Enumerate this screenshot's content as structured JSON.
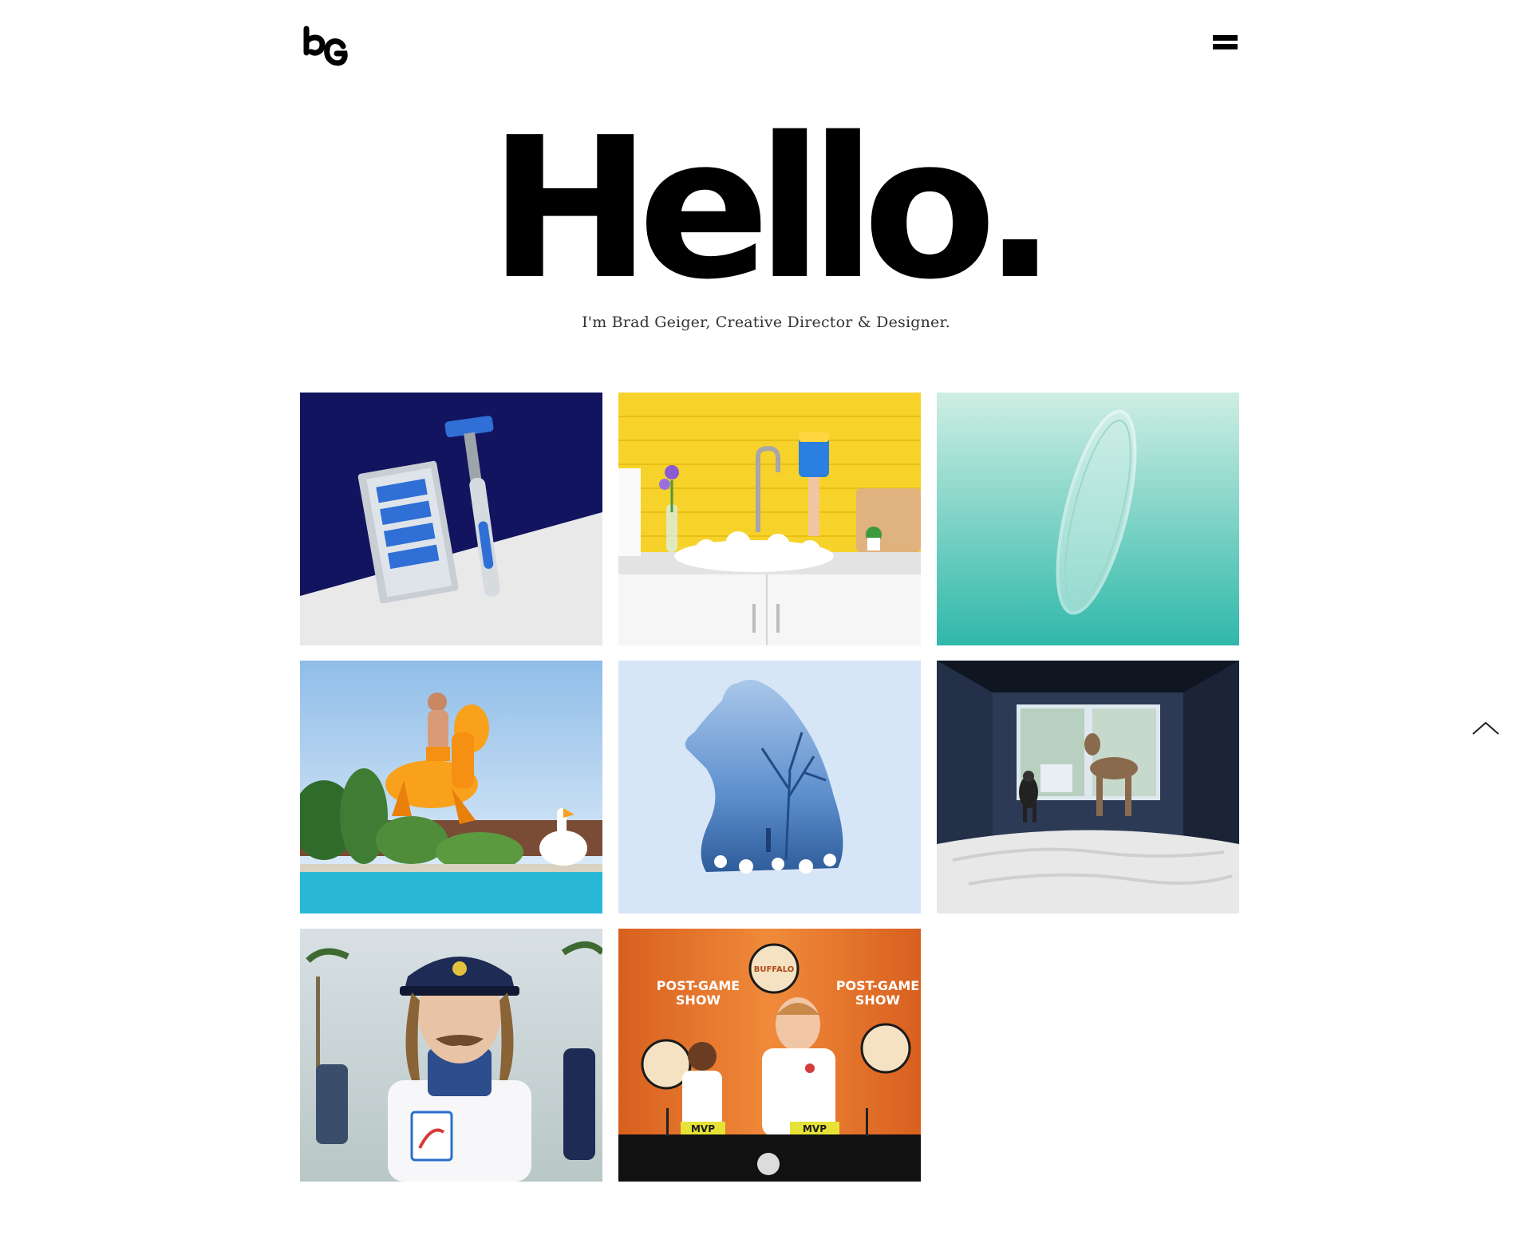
{
  "header": {
    "logo": "bG",
    "logo_icon": "bg-monogram-logo",
    "menu_icon": "hamburger-menu-icon"
  },
  "hero": {
    "headline": "Hello.",
    "subtitle": "I'm Brad Geiger, Creative Director & Designer."
  },
  "portfolio": {
    "items": [
      {
        "icon": "razor-product-image",
        "accent": "#13145f"
      },
      {
        "icon": "kitchen-sink-image",
        "accent": "#f7d22a"
      },
      {
        "icon": "glass-lens-image",
        "accent": "#3cbfae"
      },
      {
        "icon": "pool-inflatable-image",
        "accent": "#f9a11b"
      },
      {
        "icon": "bear-silhouette-image",
        "accent": "#5d8fcd"
      },
      {
        "icon": "dogs-on-bed-image",
        "accent": "#1a2230"
      },
      {
        "icon": "captain-portrait-image",
        "accent": "#1e2b55"
      },
      {
        "icon": "post-game-show-image",
        "accent": "#e4712a",
        "texts": [
          "POST-GAME",
          "SHOW",
          "POST-GAME",
          "SHOW",
          "MVP",
          "MVP",
          "BUFFALO"
        ]
      }
    ]
  },
  "scroll_top_icon": "chevron-up-icon"
}
